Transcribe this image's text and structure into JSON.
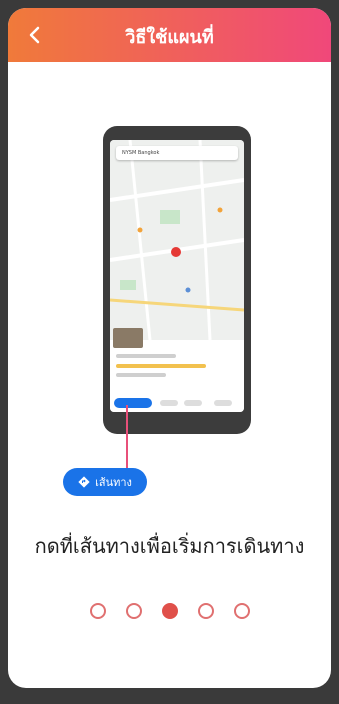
{
  "header": {
    "title": "วิธีใช้แผนที่"
  },
  "phone": {
    "search_text": "NYSM Bangkok"
  },
  "directions_button": {
    "label": "เส้นทาง"
  },
  "caption": "กดที่เส้นทางเพื่อเริ่มการเดินทาง",
  "pager": {
    "count": 5,
    "active_index": 2
  },
  "colors": {
    "header_start": "#f07a3a",
    "header_end": "#f0487a",
    "accent_blue": "#1a73e8",
    "dot": "#e0504a"
  }
}
